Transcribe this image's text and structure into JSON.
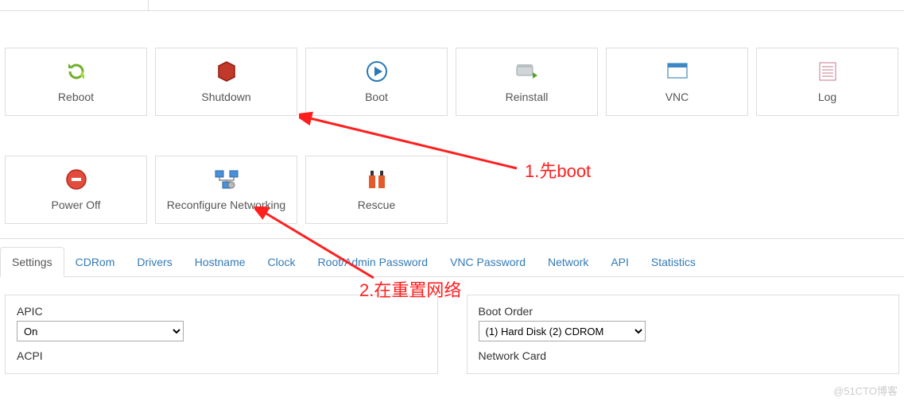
{
  "actions_row1": [
    {
      "name": "reboot-button",
      "icon": "reboot-icon",
      "label": "Reboot"
    },
    {
      "name": "shutdown-button",
      "icon": "shutdown-icon",
      "label": "Shutdown"
    },
    {
      "name": "boot-button",
      "icon": "boot-icon",
      "label": "Boot"
    },
    {
      "name": "reinstall-button",
      "icon": "reinstall-icon",
      "label": "Reinstall"
    },
    {
      "name": "vnc-button",
      "icon": "vnc-icon",
      "label": "VNC"
    },
    {
      "name": "log-button",
      "icon": "log-icon",
      "label": "Log"
    }
  ],
  "actions_row2": [
    {
      "name": "poweroff-button",
      "icon": "poweroff-icon",
      "label": "Power Off"
    },
    {
      "name": "reconfigure-networking-button",
      "icon": "reconfigure-icon",
      "label": "Reconfigure Networking"
    },
    {
      "name": "rescue-button",
      "icon": "rescue-icon",
      "label": "Rescue"
    }
  ],
  "tabs": [
    {
      "name": "tab-settings",
      "label": "Settings",
      "active": true
    },
    {
      "name": "tab-cdrom",
      "label": "CDRom"
    },
    {
      "name": "tab-drivers",
      "label": "Drivers"
    },
    {
      "name": "tab-hostname",
      "label": "Hostname"
    },
    {
      "name": "tab-clock",
      "label": "Clock"
    },
    {
      "name": "tab-root-admin-password",
      "label": "Root/Admin Password"
    },
    {
      "name": "tab-vnc-password",
      "label": "VNC Password"
    },
    {
      "name": "tab-network",
      "label": "Network"
    },
    {
      "name": "tab-api",
      "label": "API"
    },
    {
      "name": "tab-statistics",
      "label": "Statistics"
    }
  ],
  "settings": {
    "apic_label": "APIC",
    "apic_value": "On",
    "acpi_label": "ACPI",
    "boot_order_label": "Boot Order",
    "boot_order_value": "(1) Hard Disk (2) CDROM",
    "network_card_label": "Network Card"
  },
  "annotations": {
    "a1": "1.先boot",
    "a2": "2.在重置网络"
  },
  "watermark": "@51CTO博客"
}
